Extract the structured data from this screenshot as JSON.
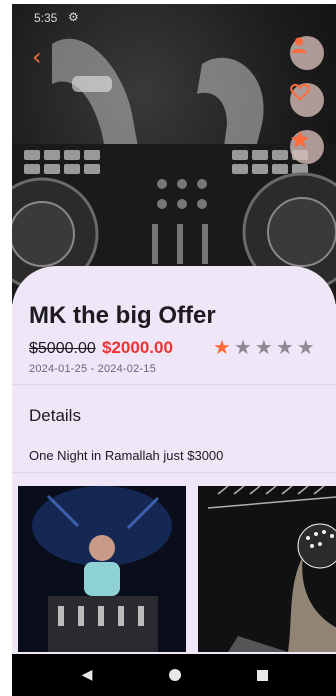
{
  "status_bar": {
    "time": "5:35",
    "settings_icon": "gear-icon"
  },
  "header": {
    "back_icon": "chevron-left-icon",
    "actions": [
      {
        "name": "profile",
        "icon": "person-icon"
      },
      {
        "name": "favorite",
        "icon": "heart-outline-icon"
      },
      {
        "name": "rate",
        "icon": "star-icon"
      }
    ]
  },
  "offer": {
    "title": "MK the big Offer",
    "old_price": "$5000.00",
    "new_price": "$2000.00",
    "rating": {
      "value": 1,
      "max": 5
    },
    "date_range": "2024-01-25 - 2024-02-15"
  },
  "details": {
    "heading": "Details",
    "description": "One Night in Ramallah just $3000"
  },
  "gallery": {
    "count_visible": 2
  },
  "colors": {
    "accent": "#ff6b3d",
    "price_red": "#ef3333",
    "sheet_bg": "#efe7f7",
    "star_active": "#ff6b3d",
    "star_inactive": "#8e8a93"
  },
  "nav": {
    "back_icon": "nav-back-icon",
    "home_icon": "nav-home-icon",
    "recent_icon": "nav-recent-icon"
  }
}
